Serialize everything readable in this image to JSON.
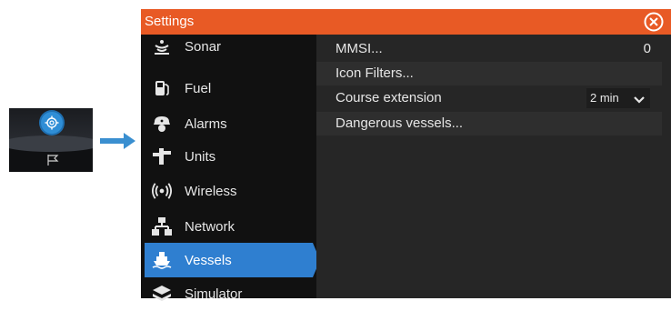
{
  "window": {
    "title": "Settings"
  },
  "sidebar": {
    "items": [
      {
        "label": "Sonar",
        "icon": "sonar-icon"
      },
      {
        "label": "Fuel",
        "icon": "fuel-pump-icon"
      },
      {
        "label": "Alarms",
        "icon": "alarm-bell-icon"
      },
      {
        "label": "Units",
        "icon": "ruler-icon"
      },
      {
        "label": "Wireless",
        "icon": "wireless-icon"
      },
      {
        "label": "Network",
        "icon": "network-icon"
      },
      {
        "label": "Vessels",
        "icon": "vessel-icon",
        "selected": true
      },
      {
        "label": "Simulator",
        "icon": "simulator-icon"
      }
    ]
  },
  "vessels": {
    "mmsi_label": "MMSI...",
    "mmsi_value": "0",
    "icon_filters_label": "Icon Filters...",
    "course_extension_label": "Course extension",
    "course_extension_value": "2 min",
    "dangerous_vessels_label": "Dangerous vessels..."
  },
  "colors": {
    "titlebar": "#e85a25",
    "selected": "#2f7fd0",
    "arrow": "#3a8fd0"
  }
}
